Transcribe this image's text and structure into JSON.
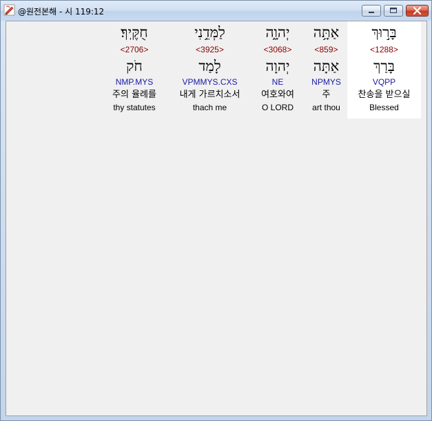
{
  "window": {
    "title": "@원전본해 - 시 119:12",
    "controls": {
      "minimize_icon": "minimize-icon",
      "maximize_icon": "maximize-icon",
      "close_icon": "close-icon"
    }
  },
  "colors": {
    "strong_number": "#8b0000",
    "morphology": "#1a1aa6",
    "selected_background": "#ffffff",
    "client_background": "#f0f0f0"
  },
  "words": [
    {
      "hebrew": "בָּר֣וּךְ",
      "strong": "<1288>",
      "lemma": "בָּרַךְ",
      "morph": "VQPP",
      "korean": "찬송을 받으실",
      "english": "Blessed",
      "selected": true
    },
    {
      "hebrew": "אַתָּ֥ה",
      "strong": "<859>",
      "lemma": "אַתָּה",
      "morph": "NPMYS",
      "korean": "주",
      "english": "art thou",
      "selected": false
    },
    {
      "hebrew": "יְהוָ֑ה",
      "strong": "<3068>",
      "lemma": "יְהוָה",
      "morph": "NE",
      "korean": "여호와여",
      "english": "O LORD",
      "selected": false
    },
    {
      "hebrew": "לַמְּדֵ֥נִי",
      "strong": "<3925>",
      "lemma": "לָמַד",
      "morph": "VPMMYS.CXS",
      "korean": "내게 가르치소서",
      "english": "thach me",
      "selected": false
    },
    {
      "hebrew": "חֻקֶּֽיךָ׃",
      "strong": "<2706>",
      "lemma": "חֹק",
      "morph": "NMP.MYS",
      "korean": "주의 율례를",
      "english": "thy statutes",
      "selected": false
    }
  ]
}
